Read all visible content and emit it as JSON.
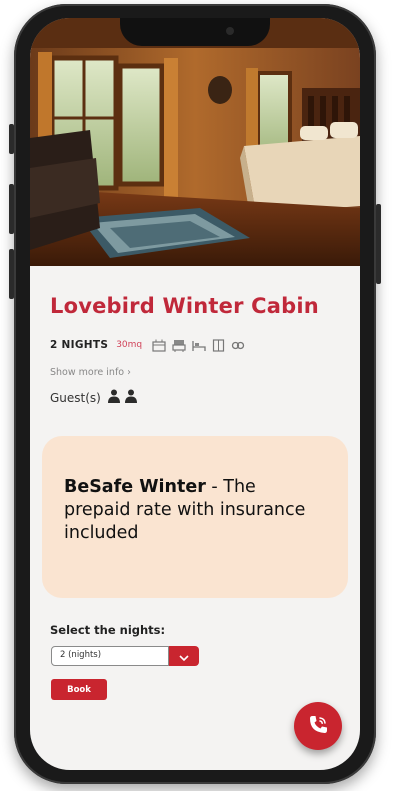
{
  "listing": {
    "title": "Lovebird Winter Cabin",
    "nights": "2 NIGHTS",
    "area": "30mq",
    "amenities": [
      "kitchen-icon",
      "bathtub-icon",
      "bed-icon",
      "wardrobe-icon",
      "parking-icon"
    ],
    "show_more": "Show more info ›",
    "guests_label": "Guest(s)",
    "guest_count": 2
  },
  "promo": {
    "bold": "BeSafe Winter",
    "text": " - The prepaid rate with insurance included"
  },
  "booking": {
    "select_label": "Select the nights:",
    "selected_nights": "2 (nights)",
    "book_label": "Book"
  },
  "colors": {
    "accent": "#c9252f",
    "title": "#c0283a",
    "promo_bg": "#fae4d1"
  }
}
